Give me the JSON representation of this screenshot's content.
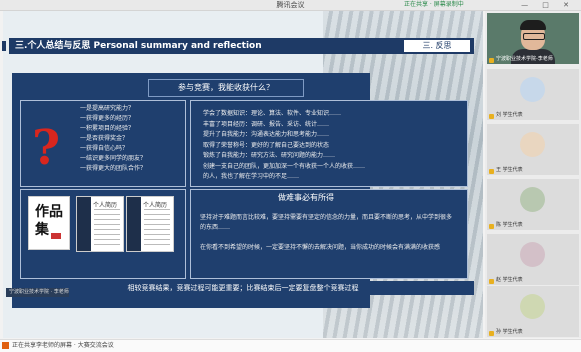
{
  "window": {
    "title": "腾讯会议",
    "share_status": "正在共享 · 屏幕录制中",
    "controls": "— □ ✕"
  },
  "slide": {
    "section_header": "三.个人总结与反思 Personal summary and reflection",
    "section_tag": "三. 反思",
    "panel_title": "参与竞赛，我能收获什么？",
    "questions": [
      "一是提高研究能力？",
      "一获得更多的经历？",
      "一积累项目的经验？",
      "一是否获得奖金？",
      "一获得自信心吗？",
      "一结识更多同学的朋友？",
      "一获得更大的团队合作？"
    ],
    "answers": [
      "学会了数据知识：理论、算法、软件、专业知识……",
      "丰富了项目经历：调研、报告、采访、统计……",
      "提升了自我能力：沟通表达能力和思考能力……",
      "取得了荣誉称号：更好的了解自己要达到的状态",
      "锻炼了自我能力：研究方法、研究问题的能力……",
      "创建一支自己的团队，更加加深一个有收获一个人的收获……",
      "的人，我也了解在学习中的不足……"
    ],
    "thumb1_text": "作品集",
    "thumb2_head": "个人简历",
    "thumb3_head": "个人简历",
    "sub2_title": "做难事必有所得",
    "para1": "坚持对于难题而言比较难，要坚持需要有坚定的信念的力量，而且要不断的思考，从中学到很多的东西……",
    "para2": "在你看不到希望的时候，一定要坚持不懈的去解决问题，当你成功的时候会有满满的收获感",
    "bottom_text": "相较竞赛结果，竞赛过程可能更重要；比赛结束后一定要复盘整个竞赛过程",
    "presenter": "宁波职业技术学院 · 李老师"
  },
  "participants": [
    {
      "name": "宁波职业技术学院-李老师",
      "type": "camera"
    },
    {
      "name": "刘 学生代表",
      "type": "avatar",
      "color": "#c7d8ea"
    },
    {
      "name": "王 学生代表",
      "type": "avatar",
      "color": "#e9d6c0"
    },
    {
      "name": "陈 学生代表",
      "type": "avatar",
      "color": "#b8c8b0"
    },
    {
      "name": "赵 学生代表",
      "type": "avatar",
      "color": "#d3c0c8"
    },
    {
      "name": "孙 学生代表",
      "type": "avatar",
      "color": "#cfd8b2"
    }
  ],
  "bottom_status": "正在共享李老师的屏幕 · 大赛交流会议"
}
